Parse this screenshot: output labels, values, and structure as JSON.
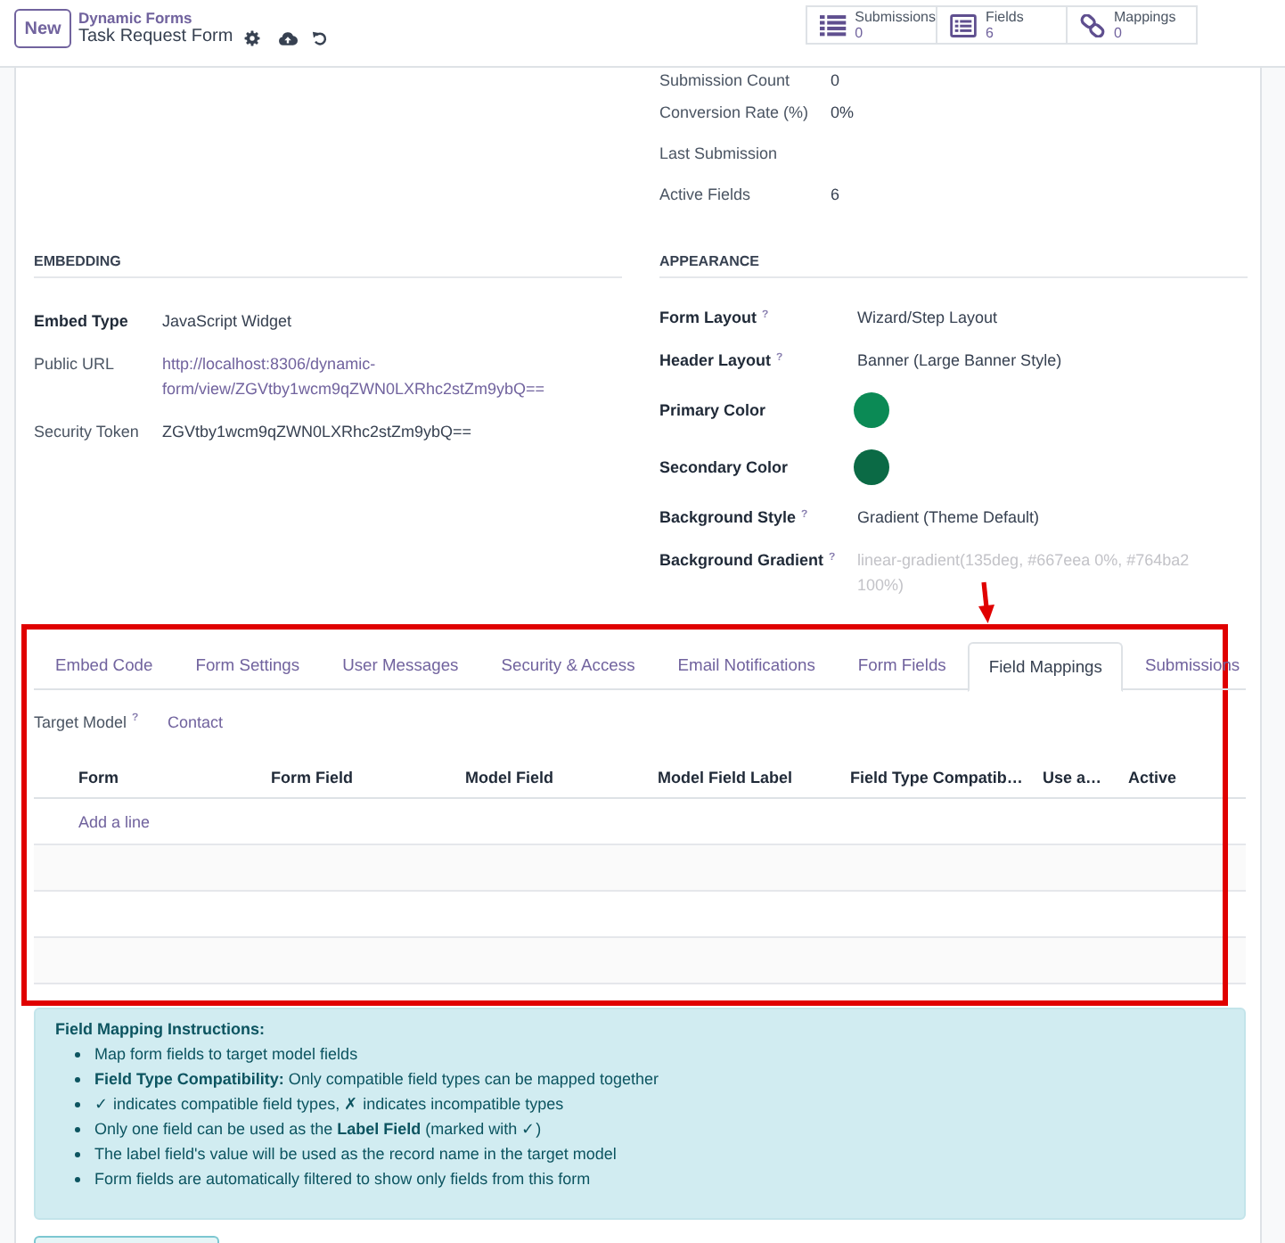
{
  "header": {
    "new_button": "New",
    "breadcrumb": "Dynamic Forms",
    "title": "Task Request Form",
    "smart_buttons": [
      {
        "kind": "list",
        "label": "Submissions",
        "count": "0"
      },
      {
        "kind": "form",
        "label": "Fields",
        "count": "6"
      },
      {
        "kind": "chain",
        "label": "Mappings",
        "count": "0"
      }
    ]
  },
  "statistics": [
    {
      "label": "Submission Count",
      "value": "0"
    },
    {
      "label": "Conversion Rate (%)",
      "value": "0%"
    },
    {
      "label": "Last Submission"
    },
    {
      "label": "Active Fields",
      "value": "6"
    }
  ],
  "embedding": {
    "title": "EMBEDDING",
    "fields": [
      {
        "label": "Embed Type",
        "readonly": false,
        "kind": "text",
        "value": "JavaScript Widget"
      },
      {
        "label": "Public URL",
        "readonly": true,
        "kind": "link",
        "value": "http://localhost:8306/dynamic-form/view/ZGVtby1wcm9qZWN0LXRhc2stZm9ybQ=="
      },
      {
        "label": "Security Token",
        "readonly": true,
        "kind": "text",
        "value": "ZGVtby1wcm9qZWN0LXRhc2stZm9ybQ=="
      }
    ]
  },
  "appearance": {
    "title": "APPEARANCE",
    "fields": [
      {
        "label": "Form Layout",
        "help": "?",
        "readonly": false,
        "kind": "text",
        "value": "Wizard/Step Layout"
      },
      {
        "label": "Header Layout",
        "help": "?",
        "readonly": false,
        "kind": "text",
        "value": "Banner (Large Banner Style)"
      },
      {
        "label": "Primary Color",
        "readonly": false,
        "kind": "color",
        "color": "#0b8a55"
      },
      {
        "label": "Secondary Color",
        "readonly": false,
        "kind": "color",
        "color": "#0b6a45"
      },
      {
        "label": "Background Style",
        "help": "?",
        "readonly": false,
        "kind": "text",
        "value": "Gradient (Theme Default)"
      },
      {
        "label": "Background Gradient",
        "help": "?",
        "readonly": false,
        "kind": "input",
        "placeholder": "linear-gradient(135deg, #667eea 0%, #764ba2 100%)"
      }
    ]
  },
  "tabs": [
    {
      "label": "Embed Code",
      "selected": false
    },
    {
      "label": "Form Settings",
      "selected": false
    },
    {
      "label": "User Messages",
      "selected": false
    },
    {
      "label": "Security & Access",
      "selected": false
    },
    {
      "label": "Email Notifications",
      "selected": false
    },
    {
      "label": "Form Fields",
      "selected": false
    },
    {
      "label": "Field Mappings",
      "selected": true
    },
    {
      "label": "Submissions",
      "selected": false
    }
  ],
  "target_model": {
    "label": "Target Model",
    "help": "?",
    "value": "Contact"
  },
  "mapping_table": {
    "columns": [
      "Form",
      "Form Field",
      "Model Field",
      "Model Field Label",
      "Field Type Compatib…",
      "Use a…",
      "Active"
    ],
    "add_line": "Add a line"
  },
  "instructions": {
    "title": "Field Mapping Instructions:",
    "items": [
      "Map form fields to target model fields",
      "**Field Type Compatibility:** Only compatible field types can be mapped together",
      "✓ indicates compatible field types, ✗ indicates incompatible types",
      "Only one field can be used as the **Label Field** (marked with ✓)",
      "The label field's value will be used as the record name in the target model",
      "Form fields are automatically filtered to show only fields from this form"
    ]
  }
}
